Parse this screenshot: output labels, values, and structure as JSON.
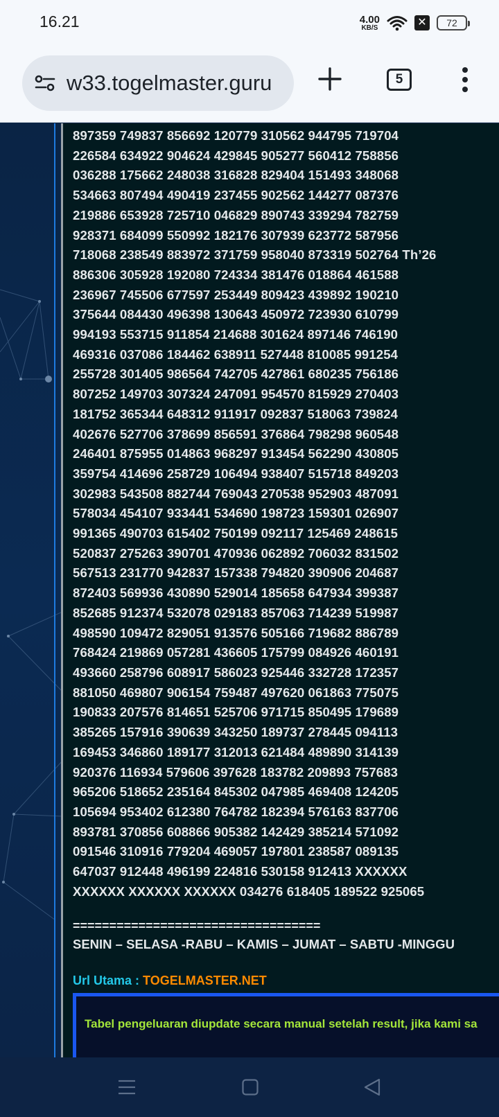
{
  "status_bar": {
    "time": "16.21",
    "net_speed_value": "4.00",
    "net_speed_unit": "KB/S",
    "battery": "72",
    "icons": [
      "wifi-icon",
      "x-notification-icon",
      "battery-icon"
    ]
  },
  "browser": {
    "url": "w33.togelmaster.guru",
    "tab_count": "5",
    "icons": [
      "site-settings-icon",
      "new-tab-plus-icon",
      "tabs-icon",
      "more-options-icon"
    ]
  },
  "results": [
    "897359 749837 856692 120779 310562 944795 719704",
    "226584 634922 904624 429845 905277 560412 758856",
    "036288 175662 248038 316828 829404 151493 348068",
    "534663 807494 490419 237455 902562 144277 087376",
    "219886 653928 725710 046829 890743 339294 782759",
    "928371 684099 550992 182176 307939 623772 587956",
    "718068 238549 883972 371759 958040 873319 502764 Th’26",
    "886306 305928 192080 724334 381476 018864 461588",
    "236967 745506 677597 253449 809423 439892 190210",
    "375644 084430 496398 130643 450972 723930 610799",
    "994193 553715 911854 214688 301624 897146 746190",
    "469316 037086 184462 638911 527448 810085 991254",
    "255728 301405 986564 742705 427861 680235 756186",
    "807252 149703 307324 247091 954570 815929 270403",
    "181752 365344 648312 911917 092837 518063 739824",
    "402676 527706 378699 856591 376864 798298 960548",
    "246401 875955 014863 968297 913454 562290 430805",
    "359754 414696 258729 106494 938407 515718 849203",
    "302983 543508 882744 769043 270538 952903 487091",
    "578034 454107 933441 534690 198723 159301 026907",
    "991365 490703 615402 750199 092117 125469 248615",
    "520837 275263 390701 470936 062892 706032 831502",
    "567513 231770 942837 157338 794820 390906 204687",
    "872403 569936 430890 529014 185658 647934 399387",
    "852685 912374 532078 029183 857063 714239 519987",
    "498590 109472 829051 913576 505166 719682 886789",
    "768424 219869 057281 436605 175799 084926 460191",
    "493660 258796 608917 586023 925446 332728 172357",
    "881050 469807 906154 759487 497620 061863 775075",
    "190833 207576 814651 525706 971715 850495 179689",
    "385265 157916 390639 343250 189737 278445 094113",
    "169453 346860 189177 312013 621484 489890 314139",
    "920376 116934 579606 397628 183782 209893 757683",
    "965206 518652 235164 845302 047985 469408 124205",
    "105694 953402 612380 764782 182394 576163 837706",
    "893781 370856 608866 905382 142429 385214 571092",
    "091546 310916 779204 469057 197801 238587 089135",
    "647037 912448 496199 224816 530158 912413 XXXXXX",
    "XXXXXX XXXXXX XXXXXX 034276 618405 189522 925065"
  ],
  "separator": "==================================",
  "days_line": "SENIN – SELASA -RABU – KAMIS – JUMAT – SABTU -MINGGU",
  "url_main": {
    "label": "Url Utama : ",
    "value": "TOGELMASTER.NET"
  },
  "notice": "Tabel pengeluaran diupdate secara manual setelah result, jika kami sa",
  "nav_bar": {
    "icons": [
      "menu-icon",
      "home-icon",
      "back-icon"
    ]
  },
  "colors": {
    "page_bg": "#0b2446",
    "content_bg": "#021a1f",
    "text": "#e4e8ea",
    "url_label": "#23c8e8",
    "url_value": "#ff8a00",
    "notice_text": "#a4e63a",
    "notice_border": "#1a57f0",
    "accent_rule": "#1e7be0"
  }
}
